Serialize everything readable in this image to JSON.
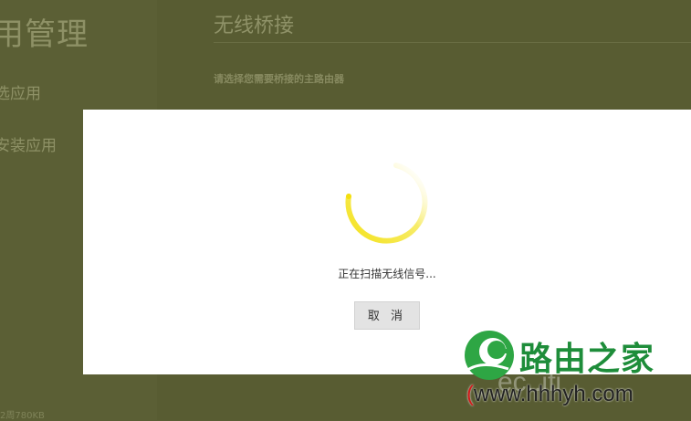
{
  "sidebar": {
    "title": "用管理",
    "items": [
      {
        "label": "选应用"
      },
      {
        "label": "安装应用"
      }
    ],
    "storage_text": "2周780KB"
  },
  "main": {
    "title": "无线桥接",
    "subtitle": "请选择您需要桥接的主路由器"
  },
  "modal": {
    "status_text": "正在扫描无线信号...",
    "cancel_label": "取 消",
    "spinner_color": "#f6e83a"
  },
  "watermark": {
    "brand_name": "路由之家",
    "url_open": "(",
    "url_text": "www.hhhyh.com",
    "ghost_text": "ec..ifi"
  }
}
